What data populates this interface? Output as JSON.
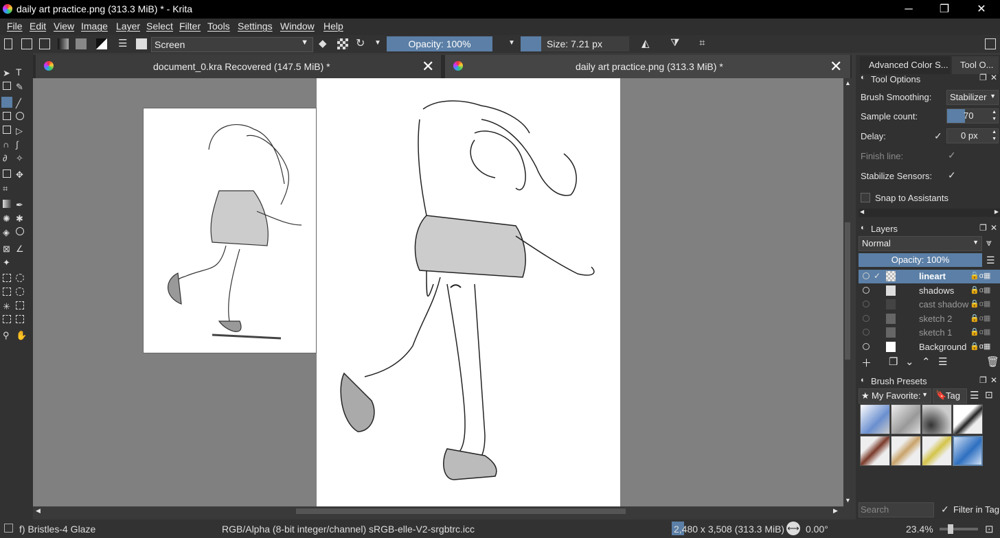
{
  "window": {
    "title": "daily art practice.png (313.3 MiB) * - Krita",
    "minimize": "─",
    "restore": "❐",
    "close": "✕"
  },
  "menu": [
    "File",
    "Edit",
    "View",
    "Image",
    "Layer",
    "Select",
    "Filter",
    "Tools",
    "Settings",
    "Window",
    "Help"
  ],
  "toolbar": {
    "blend_mode": "Screen",
    "opacity": "Opacity: 100%",
    "size": "Size: 7.21 px"
  },
  "tabs": [
    {
      "label": "document_0.kra Recovered (147.5 MiB) *",
      "close": "✕"
    },
    {
      "label": "daily art practice.png (313.3 MiB) *",
      "close": "✕"
    }
  ],
  "dock_tabs": [
    "Advanced Color S...",
    "Tool O..."
  ],
  "tool_options": {
    "title": "Tool Options",
    "brush_smoothing_label": "Brush Smoothing:",
    "brush_smoothing_value": "Stabilizer",
    "sample_count_label": "Sample count:",
    "sample_count_value": "70",
    "delay_label": "Delay:",
    "delay_value": "0 px",
    "finish_line_label": "Finish line:",
    "stabilize_sensors_label": "Stabilize Sensors:",
    "snap_label": "Snap to Assistants"
  },
  "layers_panel": {
    "title": "Layers",
    "blend": "Normal",
    "opacity": "Opacity: 100%",
    "layers": [
      {
        "name": "lineart",
        "visible": true,
        "selected": true
      },
      {
        "name": "shadows",
        "visible": true,
        "selected": false
      },
      {
        "name": "cast shadow",
        "visible": false,
        "selected": false
      },
      {
        "name": "sketch 2",
        "visible": false,
        "selected": false
      },
      {
        "name": "sketch 1",
        "visible": false,
        "selected": false
      },
      {
        "name": "Background",
        "visible": true,
        "selected": false
      }
    ]
  },
  "brush_presets": {
    "title": "Brush Presets",
    "filter": "My Favorite:",
    "tag": "Tag",
    "search_placeholder": "Search",
    "filter_in_tag": "Filter in Tag"
  },
  "status": {
    "brush": "f) Bristles-4 Glaze",
    "color_space": "RGB/Alpha (8-bit integer/channel)  sRGB-elle-V2-srgbtrc.icc",
    "dimensions": "2,480 x 3,508 (313.3 MiB)",
    "rotation": "0.00°",
    "zoom": "23.4%"
  },
  "colors": {
    "accent": "#5b7fa6",
    "titlebar": "#000000",
    "canvas_bg": "#808080"
  }
}
